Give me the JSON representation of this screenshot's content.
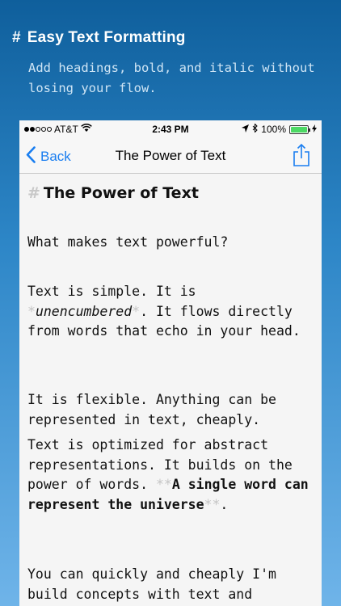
{
  "promo": {
    "hash": "#",
    "title": "Easy Text Formatting",
    "subtitle": "Add headings, bold, and italic without losing your flow."
  },
  "status_bar": {
    "carrier": "AT&T",
    "time": "2:43 PM",
    "battery": "100%",
    "battery_level": 1.0
  },
  "nav": {
    "back_label": "Back",
    "title": "The Power of Text"
  },
  "document": {
    "heading_marker": "#",
    "heading": "The Power of Text",
    "p1": "What makes text powerful?",
    "p2_a": "Text is simple. It is ",
    "p2_marker_open": "*",
    "p2_em": "unencumbered",
    "p2_marker_close": "*",
    "p2_b": ". It flows directly from words that echo in your head.",
    "p3": "It is flexible. Anything can be represented in text, cheaply.",
    "p4_a": "Text is optimized for abstract representations. It builds on the power of words. ",
    "p4_marker_open": "**",
    "p4_strong": "A single word can represent the universe",
    "p4_marker_close": "**",
    "p4_b": ".",
    "p5": "You can quickly and cheaply I'm build concepts with text and"
  }
}
